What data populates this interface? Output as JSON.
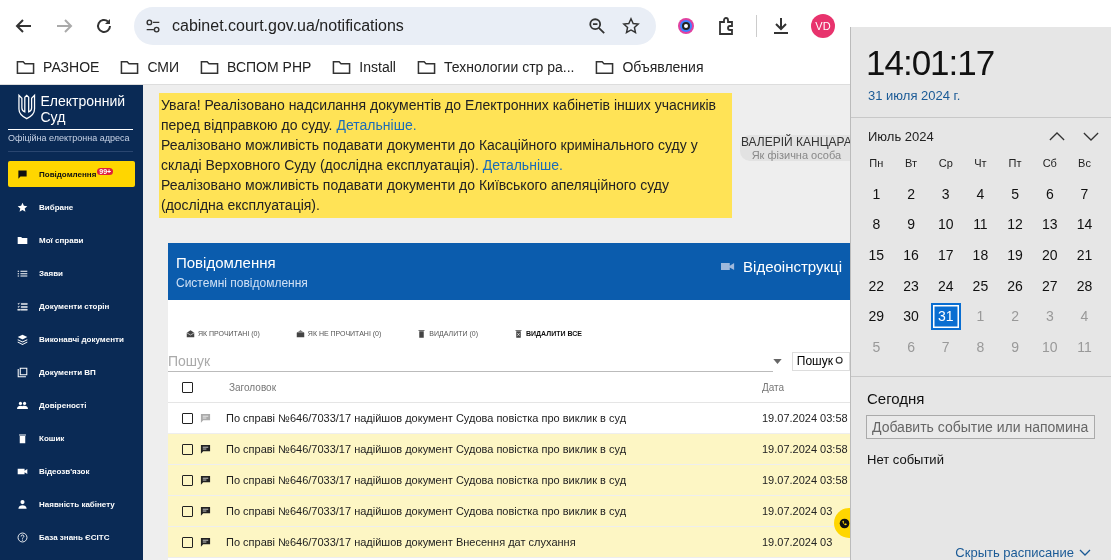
{
  "browser": {
    "url": "cabinet.court.gov.ua/notifications",
    "avatar": "VD",
    "bookmarks": [
      "РАЗНОЕ",
      "СМИ",
      "ВСПОМ PHP",
      "Install",
      "Технологии стр ра...",
      "Объявления"
    ]
  },
  "sidebar": {
    "logo_title": "Електронний Суд",
    "logo_subtitle": "Офіційна електронна адреса",
    "items": [
      {
        "label": "Повідомлення",
        "badge": "99+",
        "selected": true
      },
      {
        "label": "Вибране",
        "selected": false
      },
      {
        "label": "Мої справи",
        "selected": false
      },
      {
        "label": "Заяви",
        "selected": false
      },
      {
        "label": "Документи сторін",
        "selected": false
      },
      {
        "label": "Виконавчі документи",
        "selected": false
      },
      {
        "label": "Документи ВП",
        "selected": false
      },
      {
        "label": "Довіреності",
        "selected": false
      },
      {
        "label": "Кошик",
        "selected": false
      },
      {
        "label": "Відеозв'язок",
        "selected": false
      },
      {
        "label": "Наявність кабінету",
        "selected": false
      },
      {
        "label": "База знань ЄСІТС",
        "selected": false
      }
    ]
  },
  "banner": [
    {
      "text": "Увага! Реалізовано надсилання документів до Електронних кабінетів інших учасників перед відправкою до суду.",
      "link": "Детальніше."
    },
    {
      "text": "Реалізовано можливість подавати документи до Касаційного кримінального суду у складі Верховного Суду (дослідна експлуатація).",
      "link": "Детальніше."
    },
    {
      "text": "Реалізовано можливість подавати документи до Київського апеляційного суду (дослідна експлуатація)."
    }
  ],
  "user": {
    "name": "ВАЛЕРІЙ КАНЦАРА",
    "role": "Як фізична особа"
  },
  "panel": {
    "title": "Повідомлення",
    "subtitle": "Системні повідомлення",
    "video_link": "Відеоінструкці"
  },
  "actions": [
    {
      "label": "ЯК ПРОЧИТАНІ (0)",
      "disabled": true
    },
    {
      "label": "ЯК НЕ ПРОЧИТАНІ (0)",
      "disabled": true
    },
    {
      "label": "ВИДАЛИТИ (0)",
      "disabled": true
    },
    {
      "label": "ВИДАЛИТИ ВСЕ",
      "disabled": false
    }
  ],
  "search": {
    "placeholder": "Пошук",
    "button": "Пошук"
  },
  "table": {
    "select_all_checked": false,
    "columns": [
      "Заголовок",
      "Дата"
    ],
    "rows": [
      {
        "title": "По справі №646/7033/17 надійшов документ Судова повістка про виклик в суд",
        "date": "19.07.2024 03:58",
        "read": true,
        "checked": false
      },
      {
        "title": "По справі №646/7033/17 надійшов документ Судова повістка про виклик в суд",
        "date": "19.07.2024 03:58",
        "read": false,
        "checked": false
      },
      {
        "title": "По справі №646/7033/17 надійшов документ Судова повістка про виклик в суд",
        "date": "19.07.2024 03:58",
        "read": false,
        "checked": false
      },
      {
        "title": "По справі №646/7033/17 надійшов документ Судова повістка про виклик в суд",
        "date": "19.07.2024 03",
        "read": false,
        "checked": false
      },
      {
        "title": "По справі №646/7033/17 надійшов документ Внесення дат слухання",
        "date": "19.07.2024 03",
        "read": false,
        "checked": false
      }
    ]
  },
  "calendar": {
    "time": "14:01:17",
    "date": "31 июля 2024 г.",
    "month": "Июль 2024",
    "weekdays": [
      "Пн",
      "Вт",
      "Ср",
      "Чт",
      "Пт",
      "Сб",
      "Вс"
    ],
    "weeks": [
      [
        {
          "day": "1",
          "in_month": true,
          "selected": false
        },
        {
          "day": "2",
          "in_month": true,
          "selected": false
        },
        {
          "day": "3",
          "in_month": true,
          "selected": false
        },
        {
          "day": "4",
          "in_month": true,
          "selected": false
        },
        {
          "day": "5",
          "in_month": true,
          "selected": false
        },
        {
          "day": "6",
          "in_month": true,
          "selected": false
        },
        {
          "day": "7",
          "in_month": true,
          "selected": false
        }
      ],
      [
        {
          "day": "8",
          "in_month": true,
          "selected": false
        },
        {
          "day": "9",
          "in_month": true,
          "selected": false
        },
        {
          "day": "10",
          "in_month": true,
          "selected": false
        },
        {
          "day": "11",
          "in_month": true,
          "selected": false
        },
        {
          "day": "12",
          "in_month": true,
          "selected": false
        },
        {
          "day": "13",
          "in_month": true,
          "selected": false
        },
        {
          "day": "14",
          "in_month": true,
          "selected": false
        }
      ],
      [
        {
          "day": "15",
          "in_month": true,
          "selected": false
        },
        {
          "day": "16",
          "in_month": true,
          "selected": false
        },
        {
          "day": "17",
          "in_month": true,
          "selected": false
        },
        {
          "day": "18",
          "in_month": true,
          "selected": false
        },
        {
          "day": "19",
          "in_month": true,
          "selected": false
        },
        {
          "day": "20",
          "in_month": true,
          "selected": false
        },
        {
          "day": "21",
          "in_month": true,
          "selected": false
        }
      ],
      [
        {
          "day": "22",
          "in_month": true,
          "selected": false
        },
        {
          "day": "23",
          "in_month": true,
          "selected": false
        },
        {
          "day": "24",
          "in_month": true,
          "selected": false
        },
        {
          "day": "25",
          "in_month": true,
          "selected": false
        },
        {
          "day": "26",
          "in_month": true,
          "selected": false
        },
        {
          "day": "27",
          "in_month": true,
          "selected": false
        },
        {
          "day": "28",
          "in_month": true,
          "selected": false
        }
      ],
      [
        {
          "day": "29",
          "in_month": true,
          "selected": false
        },
        {
          "day": "30",
          "in_month": true,
          "selected": false
        },
        {
          "day": "31",
          "in_month": true,
          "selected": true
        },
        {
          "day": "1",
          "in_month": false,
          "selected": false
        },
        {
          "day": "2",
          "in_month": false,
          "selected": false
        },
        {
          "day": "3",
          "in_month": false,
          "selected": false
        },
        {
          "day": "4",
          "in_month": false,
          "selected": false
        }
      ],
      [
        {
          "day": "5",
          "in_month": false,
          "selected": false
        },
        {
          "day": "6",
          "in_month": false,
          "selected": false
        },
        {
          "day": "7",
          "in_month": false,
          "selected": false
        },
        {
          "day": "8",
          "in_month": false,
          "selected": false
        },
        {
          "day": "9",
          "in_month": false,
          "selected": false
        },
        {
          "day": "10",
          "in_month": false,
          "selected": false
        },
        {
          "day": "11",
          "in_month": false,
          "selected": false
        }
      ]
    ],
    "today": "Сегодня",
    "event_placeholder": "Добавить событие или напомина",
    "no_events": "Нет событий",
    "hide_link": "Скрыть расписание"
  }
}
